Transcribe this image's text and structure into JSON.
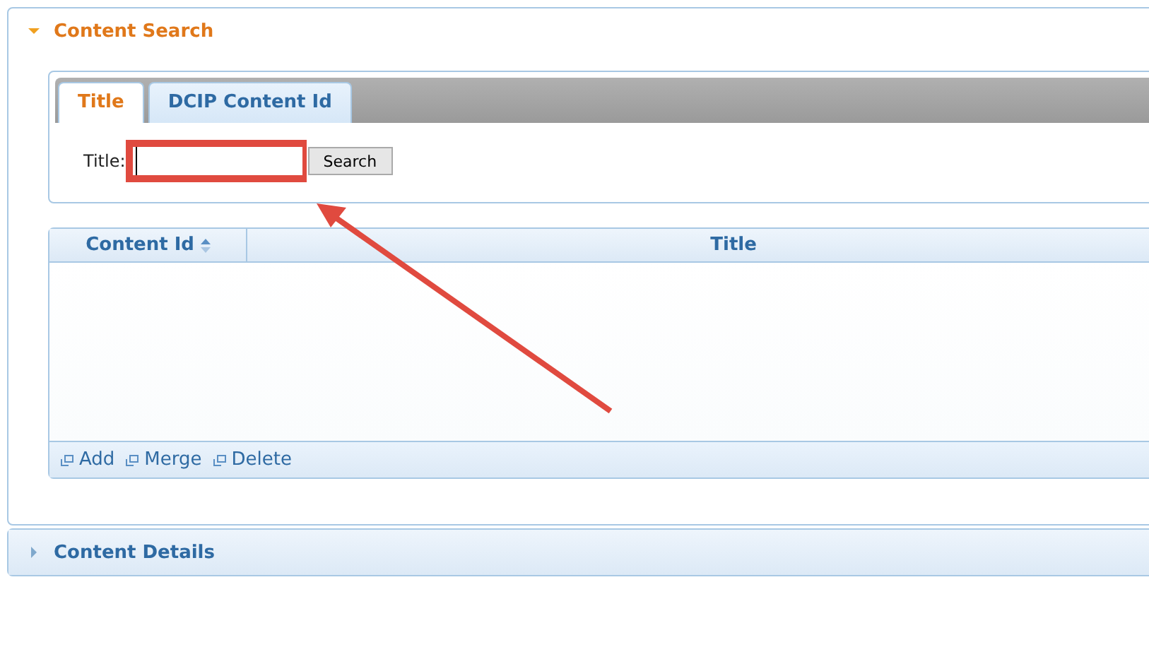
{
  "panels": [
    {
      "title": "Content Search",
      "expanded": true
    },
    {
      "title": "Content Details",
      "expanded": false
    }
  ],
  "tabs": [
    {
      "label": "Title",
      "selected": true
    },
    {
      "label": "DCIP Content Id",
      "selected": false
    }
  ],
  "search": {
    "label": "Title:",
    "button": "Search",
    "highlighted": true
  },
  "table": {
    "columns": [
      {
        "label": "Content Id",
        "sorted": true
      },
      {
        "label": "Title",
        "sorted": false
      }
    ]
  },
  "actions": [
    "Add",
    "Merge",
    "Delete"
  ],
  "annotation": {
    "kind": "arrow"
  }
}
